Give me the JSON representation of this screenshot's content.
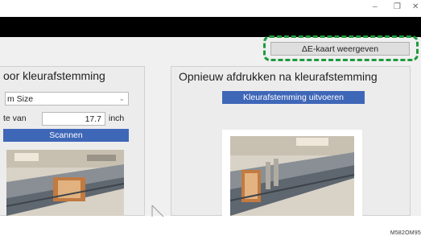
{
  "window": {
    "minimize_glyph": "–",
    "maximize_glyph": "❐",
    "close_glyph": "✕"
  },
  "toolbar": {
    "show_delta_e_map_label": "ΔE-kaart weergeven"
  },
  "left_panel": {
    "title": "oor kleurafstemming",
    "paper_size_value": "m Size",
    "width_label": "te van",
    "width_value": "17.7",
    "width_unit": "inch",
    "scan_button_label": "Scannen"
  },
  "right_panel": {
    "title": "Opnieuw afdrukken na kleurafstemming",
    "run_button_label": "Kleurafstemming uitvoeren"
  },
  "figure_id": "M582OM95"
}
